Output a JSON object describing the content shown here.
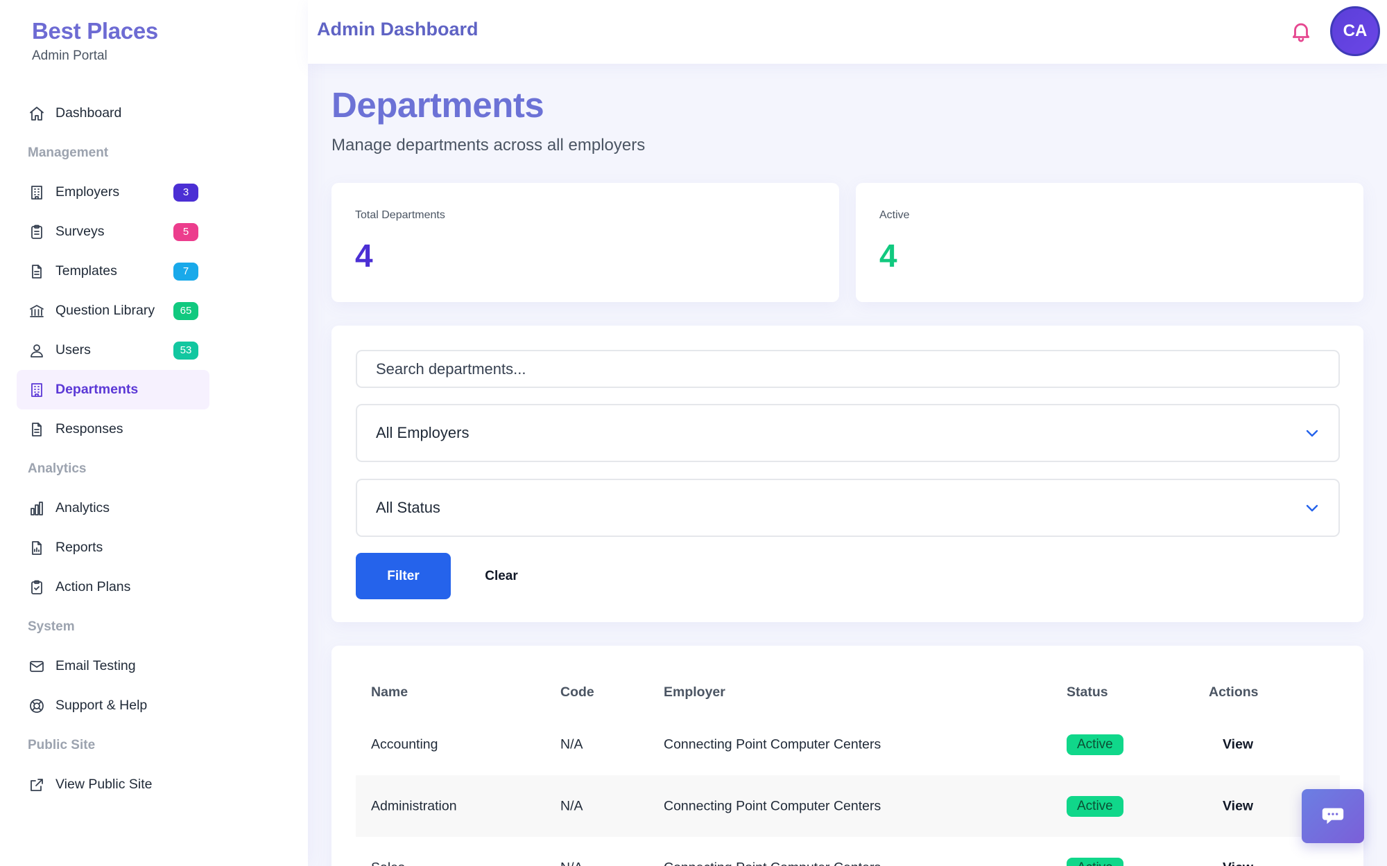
{
  "brand": {
    "title": "Best Places",
    "subtitle": "Admin Portal"
  },
  "header": {
    "title": "Admin Dashboard",
    "avatar_initials": "CA"
  },
  "sidebar": {
    "dashboard": "Dashboard",
    "sections": {
      "management": "Management",
      "analytics": "Analytics",
      "system": "System",
      "public_site": "Public Site"
    },
    "items": [
      {
        "label": "Employers",
        "icon": "building-icon",
        "badge": "3",
        "badge_color": "#4b2fd4"
      },
      {
        "label": "Surveys",
        "icon": "clipboard-icon",
        "badge": "5",
        "badge_color": "#ec3d8d"
      },
      {
        "label": "Templates",
        "icon": "document-icon",
        "badge": "7",
        "badge_color": "#19a9ea"
      },
      {
        "label": "Question Library",
        "icon": "library-icon",
        "badge": "65",
        "badge_color": "#11c97f"
      },
      {
        "label": "Users",
        "icon": "users-icon",
        "badge": "53",
        "badge_color": "#12c7a0"
      },
      {
        "label": "Departments",
        "icon": "building-icon",
        "active": true
      },
      {
        "label": "Responses",
        "icon": "document-icon"
      },
      {
        "label": "Analytics",
        "icon": "bar-chart-icon"
      },
      {
        "label": "Reports",
        "icon": "report-icon"
      },
      {
        "label": "Action Plans",
        "icon": "clipboard-check-icon"
      },
      {
        "label": "Email Testing",
        "icon": "mail-icon"
      },
      {
        "label": "Support & Help",
        "icon": "lifebuoy-icon"
      },
      {
        "label": "View Public Site",
        "icon": "external-link-icon"
      }
    ]
  },
  "page": {
    "title": "Departments",
    "subtitle": "Manage departments across all employers"
  },
  "stats": [
    {
      "label": "Total Departments",
      "value": "4",
      "color": "#4b2fd4"
    },
    {
      "label": "Active",
      "value": "4",
      "color": "#11c97f"
    }
  ],
  "filters": {
    "search_placeholder": "Search departments...",
    "employer_select": "All Employers",
    "status_select": "All Status",
    "filter_label": "Filter",
    "clear_label": "Clear"
  },
  "table": {
    "columns": [
      "Name",
      "Code",
      "Employer",
      "Status",
      "Actions"
    ],
    "rows": [
      {
        "name": "Accounting",
        "code": "N/A",
        "employer": "Connecting Point Computer Centers",
        "status": "Active",
        "action": "View"
      },
      {
        "name": "Administration",
        "code": "N/A",
        "employer": "Connecting Point Computer Centers",
        "status": "Active",
        "action": "View"
      },
      {
        "name": "Sales",
        "code": "N/A",
        "employer": "Connecting Point Computer Centers",
        "status": "Active",
        "action": "View"
      }
    ]
  },
  "colors": {
    "accent": "#2563eb",
    "brand": "#6d6bd3",
    "active_nav": "#5b38d6",
    "status_active": "#10d78a"
  }
}
